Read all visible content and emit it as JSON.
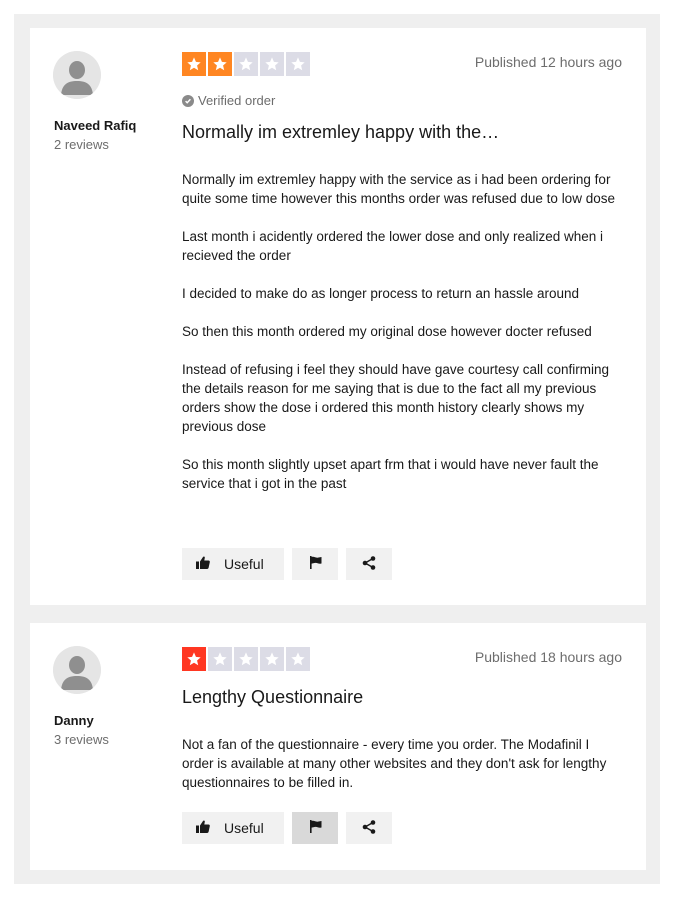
{
  "colors": {
    "star_orange": "#ff8622",
    "star_red": "#ff3722",
    "star_empty": "#dcdce6",
    "background": "#efefef",
    "card": "#ffffff"
  },
  "reviews": [
    {
      "author": {
        "name": "Naveed Rafiq",
        "review_count": "2 reviews",
        "avatar_icon": "user-silhouette-icon"
      },
      "rating": 2,
      "published": "Published 12 hours ago",
      "verified_label": "Verified order",
      "title": "Normally im extremley happy with the…",
      "paragraphs": [
        "Normally im extremley happy with the service as i had been ordering for quite some time however this months order was refused due to low dose",
        "Last month i acidently ordered the lower dose and only realized when i recieved the order",
        "I decided to make do as longer process to return an hassle around",
        "So then this month ordered my original dose however docter refused",
        "Instead of refusing i feel they should have gave courtesy call confirming the details reason for me saying that is due to the fact all my previous orders show the dose i ordered this month history clearly shows my previous dose",
        "So this month slightly upset apart frm that i would have never fault the service that i got in the past"
      ],
      "actions": {
        "useful_label": "Useful",
        "useful_icon": "thumbs-up-icon",
        "flag_icon": "flag-icon",
        "share_icon": "share-icon"
      }
    },
    {
      "author": {
        "name": "Danny",
        "review_count": "3 reviews",
        "avatar_icon": "user-silhouette-icon"
      },
      "rating": 1,
      "published": "Published 18 hours ago",
      "title": "Lengthy Questionnaire",
      "paragraphs": [
        "Not a fan of the questionnaire - every time you order. The Modafinil I order is available at many other websites and they don't ask for lengthy questionnaires to be filled in."
      ],
      "actions": {
        "useful_label": "Useful",
        "useful_icon": "thumbs-up-icon",
        "flag_icon": "flag-icon",
        "share_icon": "share-icon"
      }
    }
  ]
}
